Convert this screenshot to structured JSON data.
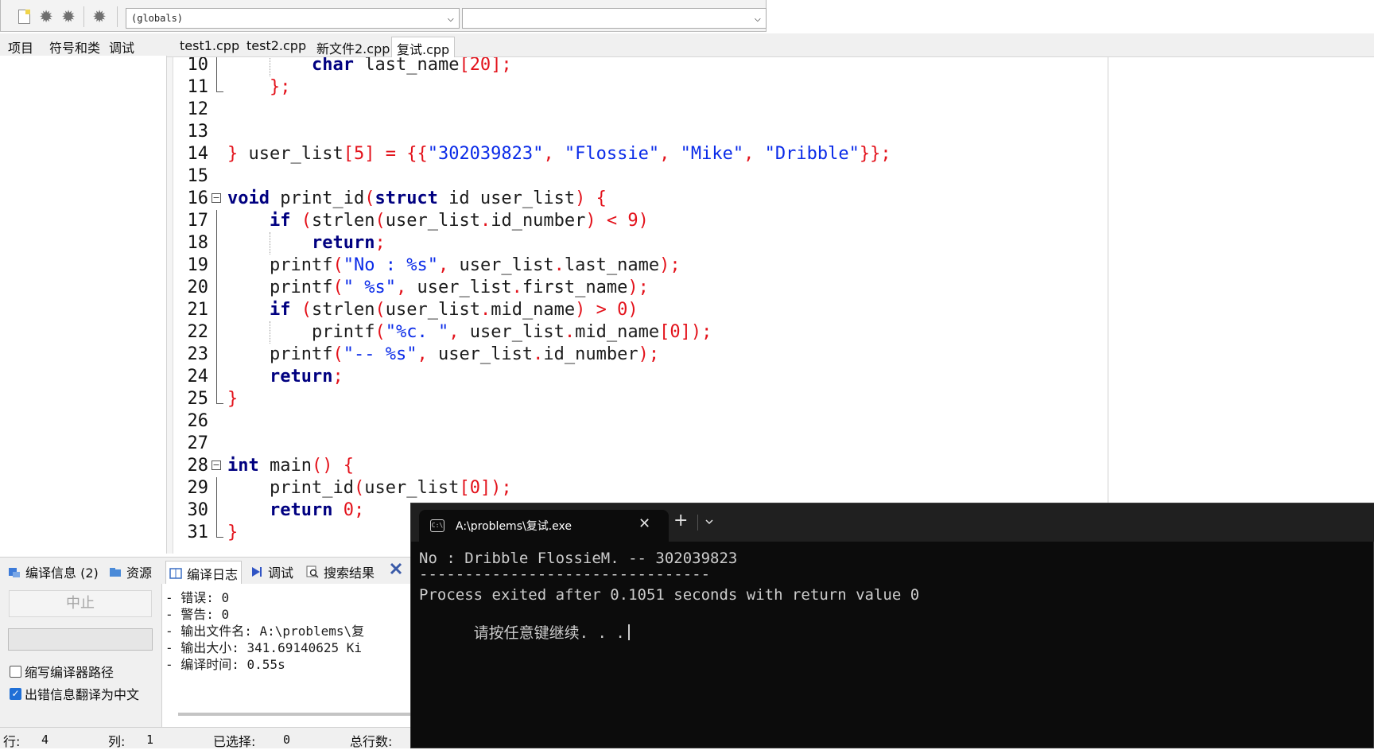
{
  "toolbar": {
    "globals_combo_value": "(globals)",
    "second_combo_value": ""
  },
  "left_tabs": [
    "项目",
    "符号和类",
    "调试"
  ],
  "editor_tabs": [
    {
      "label": "test1.cpp"
    },
    {
      "label": "test2.cpp"
    },
    {
      "label": "新文件2.cpp"
    },
    {
      "label": "复试.cpp",
      "active": true
    }
  ],
  "code_lines": [
    {
      "n": "10",
      "tokens": [
        [
          "kw",
          "char"
        ],
        [
          "plain",
          " last_name"
        ],
        [
          "sym",
          "["
        ],
        [
          "num",
          "20"
        ],
        [
          "sym",
          "];"
        ]
      ],
      "indent": 2
    },
    {
      "n": "11",
      "tokens": [
        [
          "sym",
          "};"
        ]
      ],
      "indent": 1
    },
    {
      "n": "12",
      "tokens": [],
      "indent": 0
    },
    {
      "n": "13",
      "tokens": [],
      "indent": 0
    },
    {
      "n": "14",
      "tokens": [
        [
          "sym",
          "}"
        ],
        [
          "plain",
          " user_list"
        ],
        [
          "sym",
          "["
        ],
        [
          "num",
          "5"
        ],
        [
          "sym",
          "]"
        ],
        [
          "plain",
          " "
        ],
        [
          "sym",
          "="
        ],
        [
          "plain",
          " "
        ],
        [
          "sym",
          "{{"
        ],
        [
          "str",
          "\"302039823\""
        ],
        [
          "sym",
          ","
        ],
        [
          "plain",
          " "
        ],
        [
          "str",
          "\"Flossie\""
        ],
        [
          "sym",
          ","
        ],
        [
          "plain",
          " "
        ],
        [
          "str",
          "\"Mike\""
        ],
        [
          "sym",
          ","
        ],
        [
          "plain",
          " "
        ],
        [
          "str",
          "\"Dribble\""
        ],
        [
          "sym",
          "}};"
        ]
      ],
      "indent": 0
    },
    {
      "n": "15",
      "tokens": [],
      "indent": 0
    },
    {
      "n": "16",
      "tokens": [
        [
          "kw",
          "void"
        ],
        [
          "plain",
          " print_id"
        ],
        [
          "sym",
          "("
        ],
        [
          "kw",
          "struct"
        ],
        [
          "plain",
          " id user_list"
        ],
        [
          "sym",
          ")"
        ],
        [
          "plain",
          " "
        ],
        [
          "sym",
          "{"
        ]
      ],
      "indent": 0
    },
    {
      "n": "17",
      "tokens": [
        [
          "kw",
          "if"
        ],
        [
          "plain",
          " "
        ],
        [
          "sym",
          "("
        ],
        [
          "plain",
          "strlen"
        ],
        [
          "sym",
          "("
        ],
        [
          "plain",
          "user_list"
        ],
        [
          "sym",
          "."
        ],
        [
          "plain",
          "id_number"
        ],
        [
          "sym",
          ")"
        ],
        [
          "plain",
          " "
        ],
        [
          "sym",
          "<"
        ],
        [
          "plain",
          " "
        ],
        [
          "num",
          "9"
        ],
        [
          "sym",
          ")"
        ]
      ],
      "indent": 1
    },
    {
      "n": "18",
      "tokens": [
        [
          "kw",
          "return"
        ],
        [
          "sym",
          ";"
        ]
      ],
      "indent": 2
    },
    {
      "n": "19",
      "tokens": [
        [
          "plain",
          "printf"
        ],
        [
          "sym",
          "("
        ],
        [
          "str",
          "\"No : %s\""
        ],
        [
          "sym",
          ","
        ],
        [
          "plain",
          " user_list"
        ],
        [
          "sym",
          "."
        ],
        [
          "plain",
          "last_name"
        ],
        [
          "sym",
          ");"
        ]
      ],
      "indent": 1
    },
    {
      "n": "20",
      "tokens": [
        [
          "plain",
          "printf"
        ],
        [
          "sym",
          "("
        ],
        [
          "str",
          "\" %s\""
        ],
        [
          "sym",
          ","
        ],
        [
          "plain",
          " user_list"
        ],
        [
          "sym",
          "."
        ],
        [
          "plain",
          "first_name"
        ],
        [
          "sym",
          ");"
        ]
      ],
      "indent": 1
    },
    {
      "n": "21",
      "tokens": [
        [
          "kw",
          "if"
        ],
        [
          "plain",
          " "
        ],
        [
          "sym",
          "("
        ],
        [
          "plain",
          "strlen"
        ],
        [
          "sym",
          "("
        ],
        [
          "plain",
          "user_list"
        ],
        [
          "sym",
          "."
        ],
        [
          "plain",
          "mid_name"
        ],
        [
          "sym",
          ")"
        ],
        [
          "plain",
          " "
        ],
        [
          "sym",
          ">"
        ],
        [
          "plain",
          " "
        ],
        [
          "num",
          "0"
        ],
        [
          "sym",
          ")"
        ]
      ],
      "indent": 1
    },
    {
      "n": "22",
      "tokens": [
        [
          "plain",
          "printf"
        ],
        [
          "sym",
          "("
        ],
        [
          "str",
          "\"%c. \""
        ],
        [
          "sym",
          ","
        ],
        [
          "plain",
          " user_list"
        ],
        [
          "sym",
          "."
        ],
        [
          "plain",
          "mid_name"
        ],
        [
          "sym",
          "["
        ],
        [
          "num",
          "0"
        ],
        [
          "sym",
          "]);"
        ]
      ],
      "indent": 2
    },
    {
      "n": "23",
      "tokens": [
        [
          "plain",
          "printf"
        ],
        [
          "sym",
          "("
        ],
        [
          "str",
          "\"-- %s\""
        ],
        [
          "sym",
          ","
        ],
        [
          "plain",
          " user_list"
        ],
        [
          "sym",
          "."
        ],
        [
          "plain",
          "id_number"
        ],
        [
          "sym",
          ");"
        ]
      ],
      "indent": 1
    },
    {
      "n": "24",
      "tokens": [
        [
          "kw",
          "return"
        ],
        [
          "sym",
          ";"
        ]
      ],
      "indent": 1
    },
    {
      "n": "25",
      "tokens": [
        [
          "sym",
          "}"
        ]
      ],
      "indent": 0
    },
    {
      "n": "26",
      "tokens": [],
      "indent": 0
    },
    {
      "n": "27",
      "tokens": [],
      "indent": 0
    },
    {
      "n": "28",
      "tokens": [
        [
          "kw",
          "int"
        ],
        [
          "plain",
          " main"
        ],
        [
          "sym",
          "()"
        ],
        [
          "plain",
          " "
        ],
        [
          "sym",
          "{"
        ]
      ],
      "indent": 0
    },
    {
      "n": "29",
      "tokens": [
        [
          "plain",
          "print_id"
        ],
        [
          "sym",
          "("
        ],
        [
          "plain",
          "user_list"
        ],
        [
          "sym",
          "["
        ],
        [
          "num",
          "0"
        ],
        [
          "sym",
          "]);"
        ]
      ],
      "indent": 1
    },
    {
      "n": "30",
      "tokens": [
        [
          "kw",
          "return"
        ],
        [
          "plain",
          " "
        ],
        [
          "num",
          "0"
        ],
        [
          "sym",
          ";"
        ]
      ],
      "indent": 1
    },
    {
      "n": "31",
      "tokens": [
        [
          "sym",
          "}"
        ]
      ],
      "indent": 0
    }
  ],
  "bottom_tabs": [
    {
      "label": "编译信息 (2)",
      "icon": "compile-info-icon"
    },
    {
      "label": "资源",
      "icon": "resource-icon"
    },
    {
      "label": "编译日志",
      "icon": "compile-log-icon",
      "active": true
    },
    {
      "label": "调试",
      "icon": "debug-icon"
    },
    {
      "label": "搜索结果",
      "icon": "search-icon"
    },
    {
      "label": "",
      "icon": "close-icon"
    }
  ],
  "bottom_left": {
    "stop_label": "中止",
    "checkbox_short_path": "缩写编译器路径",
    "checkbox_short_path_checked": false,
    "checkbox_translate": "出错信息翻译为中文",
    "checkbox_translate_checked": true
  },
  "compile_log": [
    "- 错误: 0",
    "- 警告: 0",
    "- 输出文件名: A:\\problems\\复",
    "- 输出大小: 341.69140625 Ki",
    "- 编译时间: 0.55s"
  ],
  "status_bar": {
    "row_label": "行:",
    "row_value": "4",
    "col_label": "列:",
    "col_value": "1",
    "selected_label": "已选择:",
    "selected_value": "0",
    "total_label": "总行数:"
  },
  "console": {
    "tab_title": "A:\\problems\\复试.exe",
    "tab_icon_text": "C:\\",
    "close_glyph": "✕",
    "new_tab_glyph": "+",
    "lines": [
      "No : Dribble FlossieM. -- 302039823",
      "--------------------------------",
      "Process exited after 0.1051 seconds with return value 0",
      "请按任意键继续. . ."
    ]
  }
}
